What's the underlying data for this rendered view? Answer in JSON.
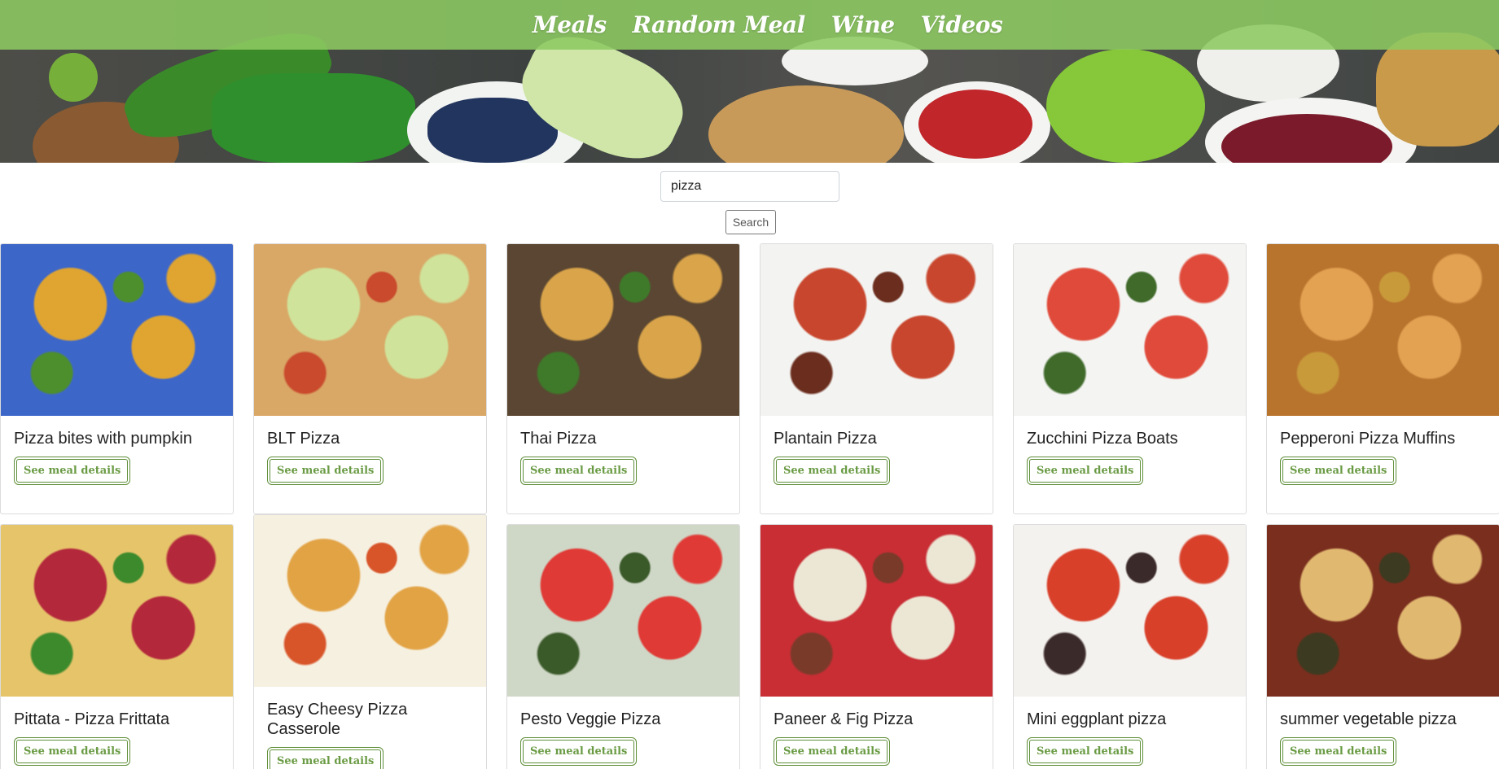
{
  "nav": {
    "items": [
      "Meals",
      "Random Meal",
      "Wine",
      "Videos"
    ]
  },
  "search": {
    "value": "pizza",
    "button_label": "Search"
  },
  "card_button_label": "See meal details",
  "meals": [
    {
      "title": "Pizza bites with pumpkin",
      "colors": [
        "#3d66c9",
        "#e0a530",
        "#4d8f2c"
      ]
    },
    {
      "title": "BLT Pizza",
      "colors": [
        "#d9a766",
        "#cfe39a",
        "#c94a2d"
      ]
    },
    {
      "title": "Thai Pizza",
      "colors": [
        "#5a4632",
        "#d9a44a",
        "#3e7a2a"
      ]
    },
    {
      "title": "Plantain Pizza",
      "colors": [
        "#f3f3f1",
        "#c8462d",
        "#6b2d1d"
      ]
    },
    {
      "title": "Zucchini Pizza Boats",
      "colors": [
        "#f4f4f2",
        "#e04a3a",
        "#3f6a2a"
      ]
    },
    {
      "title": "Pepperoni Pizza Muffins",
      "colors": [
        "#b8732d",
        "#e2a252",
        "#c89a3a"
      ]
    },
    {
      "title": "Pittata - Pizza Frittata",
      "colors": [
        "#e6c46a",
        "#b4283c",
        "#3c8a2c"
      ]
    },
    {
      "title": "Easy Cheesy Pizza Casserole",
      "colors": [
        "#f6f0e0",
        "#e2a345",
        "#d8552a"
      ]
    },
    {
      "title": "Pesto Veggie Pizza",
      "colors": [
        "#cfd7c6",
        "#e03a36",
        "#3b5a2a"
      ]
    },
    {
      "title": "Paneer & Fig Pizza",
      "colors": [
        "#c82e34",
        "#ece6d4",
        "#7a3a2a"
      ]
    },
    {
      "title": "Mini eggplant pizza",
      "colors": [
        "#f4f2ee",
        "#d8402a",
        "#3b2a2a"
      ]
    },
    {
      "title": "summer vegetable pizza",
      "colors": [
        "#7a2e1e",
        "#e0b870",
        "#3c3a20"
      ]
    }
  ]
}
